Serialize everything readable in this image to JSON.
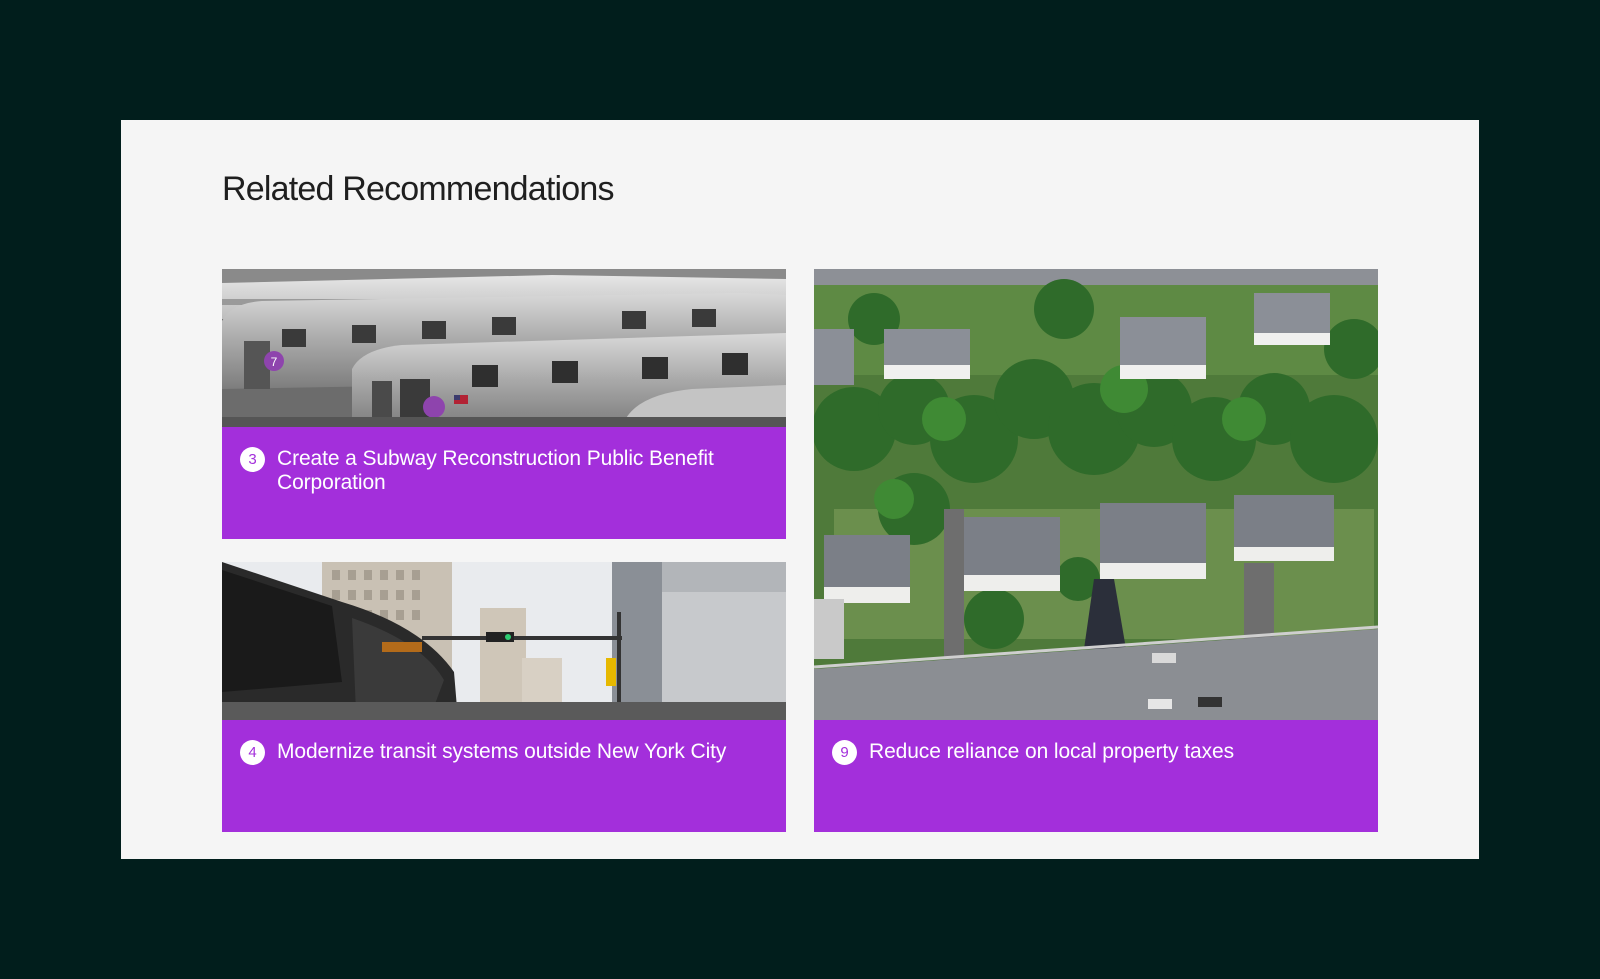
{
  "section": {
    "title": "Related Recommendations"
  },
  "cards": [
    {
      "number": "3",
      "title": "Create a Subway Reconstruction Public Benefit Corporation",
      "image": "subway-trains-photo",
      "train_label": "7"
    },
    {
      "number": "4",
      "title": "Modernize transit systems outside New York City",
      "image": "city-bus-street-photo"
    },
    {
      "number": "9",
      "title": "Reduce reliance on local property taxes",
      "image": "suburban-houses-aerial-photo"
    }
  ],
  "colors": {
    "page_background": "#011e1c",
    "panel_background": "#f5f5f5",
    "card_accent": "#a32fdb",
    "badge_background": "#ffffff"
  }
}
